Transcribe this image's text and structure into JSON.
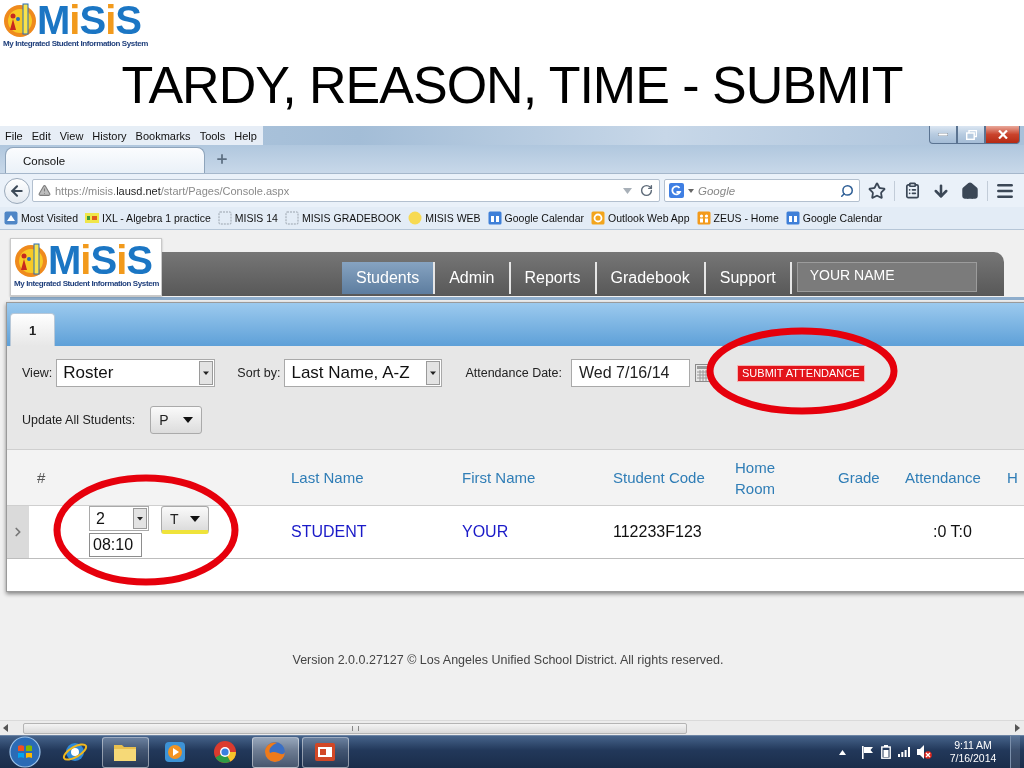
{
  "slide": {
    "logo": {
      "wordmark": [
        {
          "text": "M",
          "kind": "base"
        },
        {
          "text": "i",
          "kind": "accent"
        },
        {
          "text": "S",
          "kind": "base"
        },
        {
          "text": "i",
          "kind": "accent"
        },
        {
          "text": "S",
          "kind": "base"
        }
      ],
      "tagline": "My Integrated Student Information System"
    },
    "title": "TARDY, REASON, TIME - SUBMIT"
  },
  "browser": {
    "menu": [
      "File",
      "Edit",
      "View",
      "History",
      "Bookmarks",
      "Tools",
      "Help"
    ],
    "tabs": [
      {
        "label": "Console",
        "selected": true
      }
    ],
    "address": {
      "host_start": "https://misis.",
      "domain": "lausd.net",
      "path": "/start/Pages/Console.aspx"
    },
    "search": {
      "placeholder": "Google"
    },
    "bookmarks": [
      {
        "label": "Most Visited",
        "kind": "most-visited"
      },
      {
        "label": "IXL - Algebra 1 practice",
        "kind": "ixl"
      },
      {
        "label": "MISIS 14",
        "kind": "page"
      },
      {
        "label": "MISIS GRADEBOOK",
        "kind": "page"
      },
      {
        "label": "MISIS WEB",
        "kind": "bulb"
      },
      {
        "label": "Google Calendar",
        "kind": "calendar"
      },
      {
        "label": "Outlook Web App",
        "kind": "outlook"
      },
      {
        "label": "ZEUS - Home",
        "kind": "zeus"
      },
      {
        "label": "Google Calendar",
        "kind": "calendar"
      }
    ]
  },
  "app": {
    "logo": {
      "wordmark": [
        {
          "text": "M",
          "kind": "base"
        },
        {
          "text": "i",
          "kind": "accent"
        },
        {
          "text": "S",
          "kind": "base"
        },
        {
          "text": "i",
          "kind": "accent"
        },
        {
          "text": "S",
          "kind": "base"
        }
      ],
      "tagline": "My Integrated Student Information System"
    },
    "nav": [
      {
        "label": "Students",
        "selected": true
      },
      {
        "label": "Admin",
        "selected": false
      },
      {
        "label": "Reports",
        "selected": false
      },
      {
        "label": "Gradebook",
        "selected": false
      },
      {
        "label": "Support",
        "selected": false
      }
    ],
    "user_name": "YOUR NAME",
    "panel_tabs": [
      {
        "label": "1",
        "selected": true
      }
    ],
    "filters": {
      "view": {
        "label": "View:",
        "value": "Roster"
      },
      "sort": {
        "label": "Sort by:",
        "value": "Last Name, A-Z"
      },
      "date": {
        "label": "Attendance Date:",
        "value": "Wed 7/16/14"
      },
      "submit": {
        "label": "SUBMIT ATTENDANCE",
        "circled": true
      },
      "update_all": {
        "label": "Update All Students:",
        "value": "P"
      }
    },
    "table": {
      "columns": [
        "#",
        "Last Name",
        "First Name",
        "Student Code",
        "Home Room",
        "Grade",
        "Attendance",
        "H"
      ],
      "rows": [
        {
          "expanded": false,
          "circled": true,
          "reason": "2",
          "time": "08:10",
          "status": "T",
          "last_name": "STUDENT",
          "first_name": "YOUR",
          "student_code": "112233F123",
          "attendance": ":0 T:0"
        }
      ]
    },
    "footer": "Version 2.0.0.27127 © Los Angeles Unified School District. All rights reserved."
  },
  "taskbar": {
    "apps": [
      {
        "kind": "globe-e",
        "running": false,
        "selected": false
      },
      {
        "kind": "folder",
        "running": true,
        "selected": false
      },
      {
        "kind": "play",
        "running": false,
        "selected": false
      },
      {
        "kind": "wheel",
        "running": false,
        "selected": false
      },
      {
        "kind": "fox",
        "running": true,
        "selected": true
      },
      {
        "kind": "slides",
        "running": true,
        "selected": false
      }
    ],
    "clock": {
      "time": "9:11 AM",
      "date": "7/16/2014"
    }
  }
}
